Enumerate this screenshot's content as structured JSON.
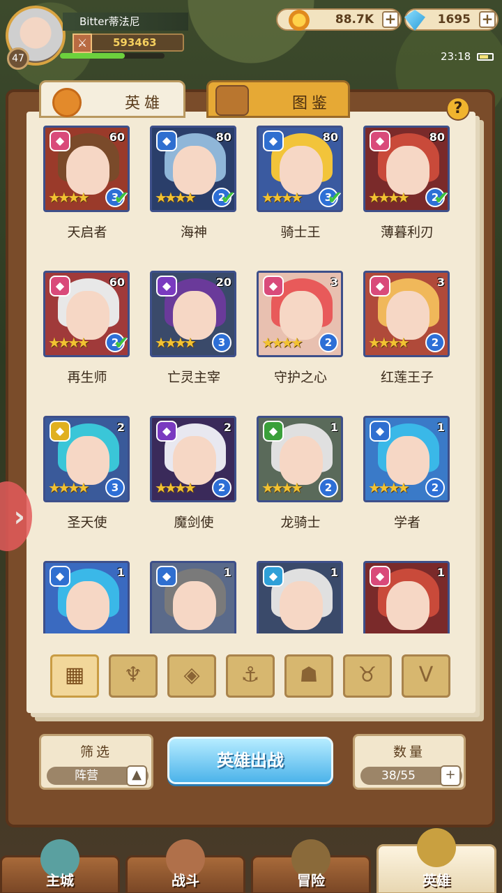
{
  "player": {
    "name": "Bitter蒂法尼",
    "level": "47",
    "power": "593463",
    "exp_fraction": 0.62
  },
  "currency": {
    "gold": "88.7K",
    "gems": "1695",
    "plus": "+"
  },
  "status": {
    "time": "23:18"
  },
  "tabs": [
    {
      "label": "英雄"
    },
    {
      "label": "图鉴"
    }
  ],
  "help": "?",
  "heroes": [
    {
      "name": "天启者",
      "level": "60",
      "stars_text": "★★★★",
      "star_count": "3",
      "checked": true,
      "faction_icon": "flame-icon",
      "faction_color": "#d94a7a",
      "hair": "#7a4a2a",
      "bg": "#9a3a2a"
    },
    {
      "name": "海神",
      "level": "80",
      "stars_text": "★★★★",
      "star_count": "2",
      "checked": true,
      "faction_icon": "anchor-icon",
      "faction_color": "#2f6fd0",
      "hair": "#8fb6d8",
      "bg": "#2a3e6a"
    },
    {
      "name": "骑士王",
      "level": "80",
      "stars_text": "★★★★",
      "star_count": "3",
      "checked": true,
      "faction_icon": "anchor-icon",
      "faction_color": "#2f6fd0",
      "hair": "#f2c43a",
      "bg": "#3a5aa0"
    },
    {
      "name": "薄暮利刃",
      "level": "80",
      "stars_text": "★★★★",
      "star_count": "2",
      "checked": true,
      "faction_icon": "flame-icon",
      "faction_color": "#d94a7a",
      "hair": "#c94a3a",
      "bg": "#7a2a2a"
    },
    {
      "name": "再生师",
      "level": "60",
      "stars_text": "★★★★",
      "star_count": "2",
      "checked": true,
      "faction_icon": "flame-icon",
      "faction_color": "#d94a7a",
      "hair": "#e8e8e8",
      "bg": "#a03a3a"
    },
    {
      "name": "亡灵主宰",
      "level": "20",
      "stars_text": "★★★★",
      "star_count": "3",
      "checked": false,
      "faction_icon": "horns-icon",
      "faction_color": "#7a3ac0",
      "hair": "#6a3a9a",
      "bg": "#3a4a6a"
    },
    {
      "name": "守护之心",
      "level": "3",
      "stars_text": "★★★★",
      "star_count": "2",
      "checked": false,
      "faction_icon": "flame-icon",
      "faction_color": "#d94a7a",
      "hair": "#e85a5a",
      "bg": "#e8c0b0"
    },
    {
      "name": "红莲王子",
      "level": "3",
      "stars_text": "★★★★",
      "star_count": "2",
      "checked": false,
      "faction_icon": "flame-icon",
      "faction_color": "#d94a7a",
      "hair": "#f0b85a",
      "bg": "#b04a3a"
    },
    {
      "name": "圣天使",
      "level": "2",
      "stars_text": "★★★★",
      "star_count": "3",
      "checked": false,
      "faction_icon": "wings-icon",
      "faction_color": "#e0b020",
      "hair": "#3ac6d8",
      "bg": "#3a5a9a"
    },
    {
      "name": "魔剑使",
      "level": "2",
      "stars_text": "★★★★",
      "star_count": "2",
      "checked": false,
      "faction_icon": "horns-icon",
      "faction_color": "#7a3ac0",
      "hair": "#e8e8f0",
      "bg": "#3a2a5a"
    },
    {
      "name": "龙骑士",
      "level": "1",
      "stars_text": "★★★★",
      "star_count": "2",
      "checked": false,
      "faction_icon": "beast-icon",
      "faction_color": "#3aa03a",
      "hair": "#e0e0e0",
      "bg": "#5a6a5a"
    },
    {
      "name": "学者",
      "level": "1",
      "stars_text": "★★★★",
      "star_count": "2",
      "checked": false,
      "faction_icon": "anchor-icon",
      "faction_color": "#2f6fd0",
      "hair": "#3ab8e8",
      "bg": "#3a7ac8"
    },
    {
      "name": "",
      "level": "1",
      "stars_text": "",
      "star_count": "",
      "checked": false,
      "faction_icon": "anchor-icon",
      "faction_color": "#2f6fd0",
      "hair": "#3ab8e8",
      "bg": "#3a6ac0"
    },
    {
      "name": "",
      "level": "1",
      "stars_text": "",
      "star_count": "",
      "checked": false,
      "faction_icon": "anchor-icon",
      "faction_color": "#2f6fd0",
      "hair": "#7a7a7a",
      "bg": "#5a6a8a"
    },
    {
      "name": "",
      "level": "1",
      "stars_text": "",
      "star_count": "",
      "checked": false,
      "faction_icon": "diamond-icon",
      "faction_color": "#2fa0d8",
      "hair": "#e0e0e0",
      "bg": "#3a4a6a"
    },
    {
      "name": "",
      "level": "1",
      "stars_text": "",
      "star_count": "",
      "checked": false,
      "faction_icon": "flame-icon",
      "faction_color": "#d94a7a",
      "hair": "#c94a3a",
      "bg": "#7a2a2a"
    }
  ],
  "filters": [
    {
      "icon": "grid-icon",
      "glyph": "▦",
      "active": true
    },
    {
      "icon": "flame-icon",
      "glyph": "♆",
      "active": false
    },
    {
      "icon": "diamond-icon",
      "glyph": "◈",
      "active": false
    },
    {
      "icon": "anchor-icon",
      "glyph": "⚓",
      "active": false
    },
    {
      "icon": "beast-icon",
      "glyph": "☗",
      "active": false
    },
    {
      "icon": "horns-icon",
      "glyph": "♉",
      "active": false
    },
    {
      "icon": "wings-icon",
      "glyph": "V",
      "active": false
    }
  ],
  "controls": {
    "filter_title": "筛选",
    "filter_value": "阵营",
    "deploy_label": "英雄出战",
    "count_title": "数量",
    "count_value": "38/55"
  },
  "nav": [
    {
      "label": "主城",
      "icon": "castle-icon"
    },
    {
      "label": "战斗",
      "icon": "swords-icon"
    },
    {
      "label": "冒险",
      "icon": "map-icon"
    },
    {
      "label": "英雄",
      "icon": "crest-icon"
    }
  ]
}
